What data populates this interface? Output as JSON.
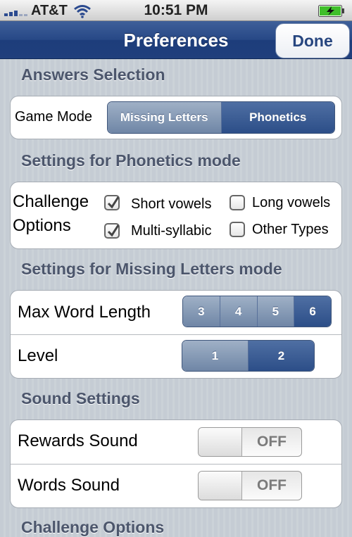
{
  "status_bar": {
    "carrier": "AT&T",
    "time": "10:51 PM",
    "icons": [
      "signal-icon",
      "wifi-icon",
      "battery-charging-icon"
    ],
    "battery_color": "#3fbf2a"
  },
  "nav": {
    "title": "Preferences",
    "done_label": "Done",
    "bar_color": "#274886"
  },
  "answers_selection": {
    "header": "Answers Selection",
    "label": "Game Mode",
    "options": [
      "Missing Letters",
      "Phonetics"
    ],
    "selected": "Phonetics"
  },
  "phonetics_settings": {
    "header": "Settings for Phonetics mode",
    "label_line1": "Challenge",
    "label_line2": "Options",
    "options": [
      {
        "label": "Short vowels",
        "checked": true
      },
      {
        "label": "Long vowels",
        "checked": false
      },
      {
        "label": "Multi-syllabic",
        "checked": true
      },
      {
        "label": "Other Types",
        "checked": false
      }
    ]
  },
  "missing_letters_settings": {
    "header": "Settings for Missing Letters mode",
    "max_word_length": {
      "label": "Max Word Length",
      "options": [
        "3",
        "4",
        "5",
        "6"
      ],
      "selected": "6"
    },
    "level": {
      "label": "Level",
      "options": [
        "1",
        "2"
      ],
      "selected": "2"
    }
  },
  "sound_settings": {
    "header": "Sound Settings",
    "rewards": {
      "label": "Rewards Sound",
      "state": "OFF"
    },
    "words": {
      "label": "Words Sound",
      "state": "OFF"
    }
  },
  "next_section": {
    "header": "Challenge Options"
  },
  "colors": {
    "segment_selected": "#2c4e88",
    "segment_unselected": "#8a9db8",
    "section_header": "#4c566c"
  }
}
